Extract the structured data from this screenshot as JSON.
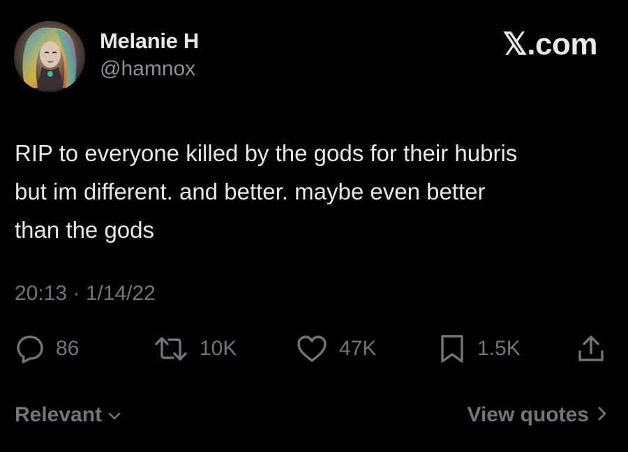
{
  "author": {
    "display_name": "Melanie H",
    "handle": "@hamnox"
  },
  "brand": "𝕏.com",
  "tweet": {
    "text": "RIP to everyone killed by the gods for their hubris\nbut im different. and better. maybe even better\nthan the gods",
    "timestamp": "20:13 · 1/14/22"
  },
  "actions": {
    "replies": "86",
    "retweets": "10K",
    "likes": "47K",
    "bookmarks": "1.5K"
  },
  "footer": {
    "sort_label": "Relevant",
    "view_quotes_label": "View quotes"
  },
  "colors": {
    "background": "#000000",
    "primary_text": "#e7e9ea",
    "secondary_text": "#71767b"
  }
}
